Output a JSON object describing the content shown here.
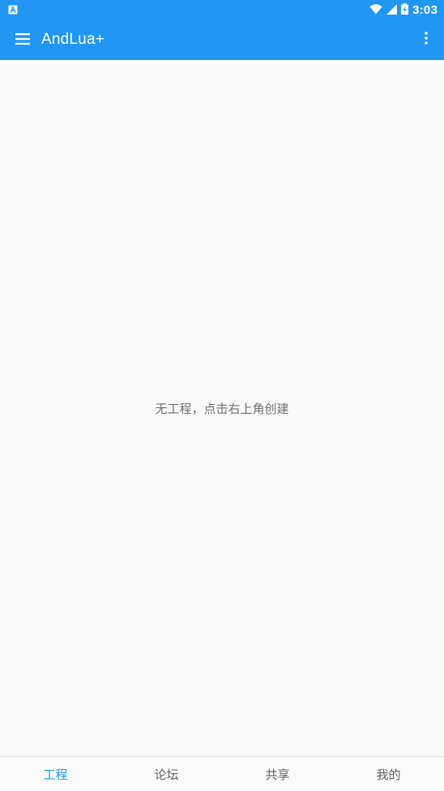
{
  "colors": {
    "primary": "#2196f3",
    "background": "#fafafa",
    "text_secondary": "#6f6f6f"
  },
  "status_bar": {
    "time": "3:03",
    "icons": [
      "notification-a-icon",
      "wifi-icon",
      "signal-icon",
      "battery-charging-icon"
    ]
  },
  "app_bar": {
    "title": "AndLua+",
    "icons": [
      "menu-icon",
      "more-vert-icon"
    ]
  },
  "content": {
    "empty_message": "无工程，点击右上角创建"
  },
  "bottom_nav": {
    "tabs": [
      {
        "label": "工程",
        "active": true
      },
      {
        "label": "论坛",
        "active": false
      },
      {
        "label": "共享",
        "active": false
      },
      {
        "label": "我的",
        "active": false
      }
    ]
  }
}
